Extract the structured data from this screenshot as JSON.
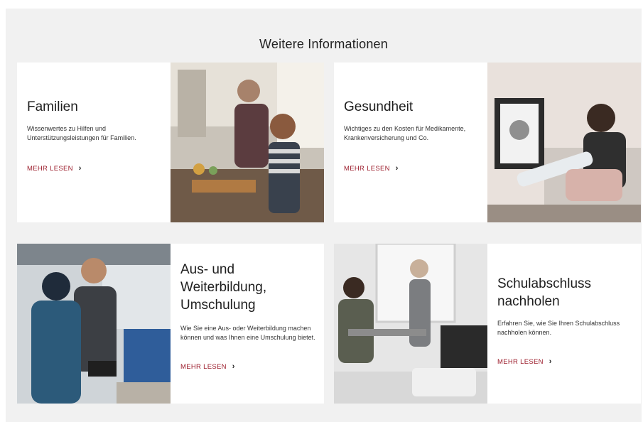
{
  "section": {
    "title": "Weitere Informationen"
  },
  "cards": [
    {
      "title": "Familien",
      "description": "Wissenwertes zu Hilfen und Unterstützungsleistungen für Familien.",
      "link": "MEHR LESEN",
      "icon": "chevron-right-icon"
    },
    {
      "title": "Gesundheit",
      "description": "Wichtiges zu den Kosten für Medikamente, Krankenversicherung und Co.",
      "link": "MEHR LESEN",
      "icon": "chevron-right-icon"
    },
    {
      "title": "Aus- und Weiterbildung, Umschulung",
      "description": "Wie Sie eine Aus- oder Weiterbildung machen können und was Ihnen eine Umschulung bietet.",
      "link": "MEHR LESEN",
      "icon": "chevron-right-icon"
    },
    {
      "title": "Schulabschluss nachholen",
      "description": "Erfahren Sie, wie Sie Ihren Schulabschluss nachholen können.",
      "link": "MEHR LESEN",
      "icon": "chevron-right-icon"
    }
  ],
  "colors": {
    "accent": "#9b1b2a",
    "background": "#f1f1f1",
    "card": "#ffffff"
  }
}
